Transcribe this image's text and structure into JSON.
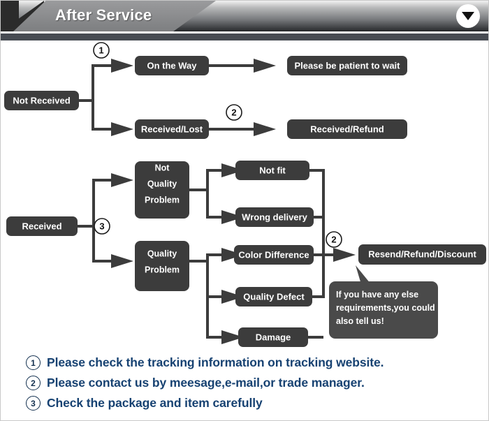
{
  "header": {
    "title": "After Service",
    "dropdown_icon": "caret-down-icon"
  },
  "flow": {
    "section_not_received": {
      "root": "Not Received",
      "marker_top": "1",
      "marker_bottom": "2",
      "branches": [
        {
          "stage": "On the Way",
          "outcome": "Please be patient to wait"
        },
        {
          "stage": "Received/Lost",
          "outcome": "Received/Refund"
        }
      ]
    },
    "section_received": {
      "root": "Received",
      "marker_root": "3",
      "marker_outcome": "2",
      "branches": [
        {
          "stage": "Not Quality Problem",
          "stage_lines": [
            "Not",
            "Quality",
            "Problem"
          ],
          "reasons": [
            "Not fit",
            "Wrong delivery"
          ]
        },
        {
          "stage": "Quality Problem",
          "stage_lines": [
            "Quality",
            "Problem"
          ],
          "reasons": [
            "Color Difference",
            "Quality Defect",
            "Damage"
          ]
        }
      ],
      "outcome": "Resend/Refund/Discount",
      "callout_lines": [
        "If you have any else",
        "requirements,you could",
        "also tell us!"
      ]
    }
  },
  "footer": {
    "notes": [
      {
        "marker": "1",
        "text": "Please check the tracking information on tracking website."
      },
      {
        "marker": "2",
        "text": "Please contact us by meesage,e-mail,or trade manager."
      },
      {
        "marker": "3",
        "text": "Check the package and item carefully"
      }
    ]
  },
  "colors": {
    "node_fill": "#3c3c3c",
    "header_bar": "#474b52",
    "footer_text": "#174272",
    "callout_fill": "#4a4a4a"
  }
}
